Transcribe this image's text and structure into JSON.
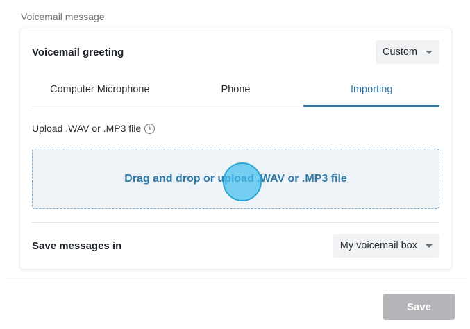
{
  "section": {
    "title": "Voicemail message"
  },
  "greeting": {
    "title": "Voicemail greeting",
    "select_value": "Custom"
  },
  "tabs": [
    {
      "label": "Computer Microphone",
      "active": false
    },
    {
      "label": "Phone",
      "active": false
    },
    {
      "label": "Importing",
      "active": true
    }
  ],
  "upload": {
    "label": "Upload .WAV or .MP3 file",
    "info_icon": "info-icon",
    "dropzone_text": "Drag and drop or upload .WAV or .MP3 file"
  },
  "save_messages": {
    "title": "Save messages in",
    "select_value": "My voicemail box"
  },
  "footer": {
    "save_label": "Save"
  },
  "colors": {
    "accent": "#2f7aa7",
    "dropzone_bg": "#eef3f8",
    "disabled_button": "#b3b5b8"
  }
}
